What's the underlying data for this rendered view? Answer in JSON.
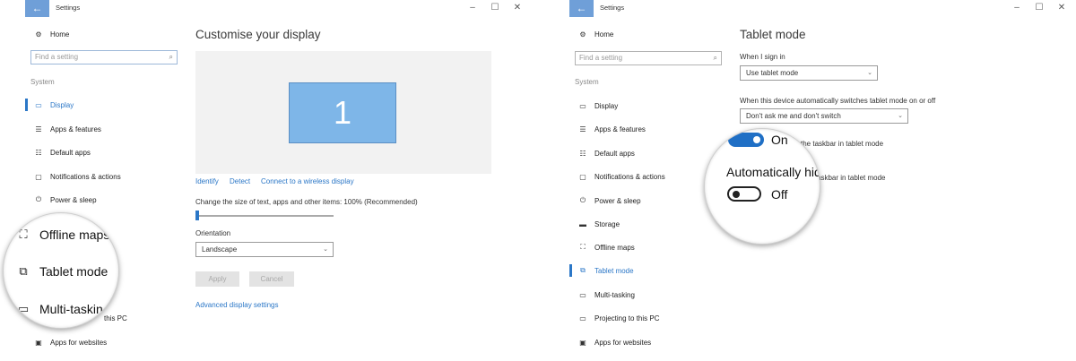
{
  "winA": {
    "title": "Settings",
    "back_icon": "back-arrow-icon",
    "nav": {
      "home": "Home",
      "search_placeholder": "Find a setting",
      "group": "System",
      "items": [
        "Display",
        "Apps & features",
        "Default apps",
        "Notifications & actions",
        "Power & sleep",
        "this PC",
        "Apps for websites"
      ]
    },
    "content": {
      "heading": "Customise your display",
      "monitor_number": "1",
      "links": [
        "Identify",
        "Detect",
        "Connect to a wireless display"
      ],
      "scale_label": "Change the size of text, apps and other items: 100% (Recommended)",
      "scale_value_percent": 0,
      "orientation_label": "Orientation",
      "orientation_value": "Landscape",
      "apply": "Apply",
      "cancel": "Cancel",
      "advanced_link": "Advanced display settings"
    },
    "magnifier": {
      "items": [
        "Offline maps",
        "Tablet mode",
        "Multi-taskin"
      ]
    }
  },
  "winB": {
    "title": "Settings",
    "back_icon": "back-arrow-icon",
    "nav": {
      "home": "Home",
      "search_placeholder": "Find a setting",
      "group": "System",
      "items": [
        "Display",
        "Apps & features",
        "Default apps",
        "Notifications & actions",
        "Power & sleep",
        "Storage",
        "Offline maps",
        "Tablet mode",
        "Multi-tasking",
        "Projecting to this PC",
        "Apps for websites"
      ]
    },
    "content": {
      "heading": "Tablet mode",
      "signin_label": "When I sign in",
      "signin_value": "Use tablet mode",
      "switch_label": "When this device automatically switches tablet mode on or off",
      "switch_value": "Don't ask me and don't switch",
      "hide_taskbar_partial": "the taskbar in tablet mode",
      "auto_hide_partial": "askbar in tablet mode"
    },
    "magnifier": {
      "on_text": "On",
      "setting_partial": "Automatically hid",
      "off_text": "Off"
    }
  },
  "colors": {
    "accent": "#2b77c7",
    "monitor": "#7eb6e8",
    "back_button": "#6f9fd8"
  }
}
